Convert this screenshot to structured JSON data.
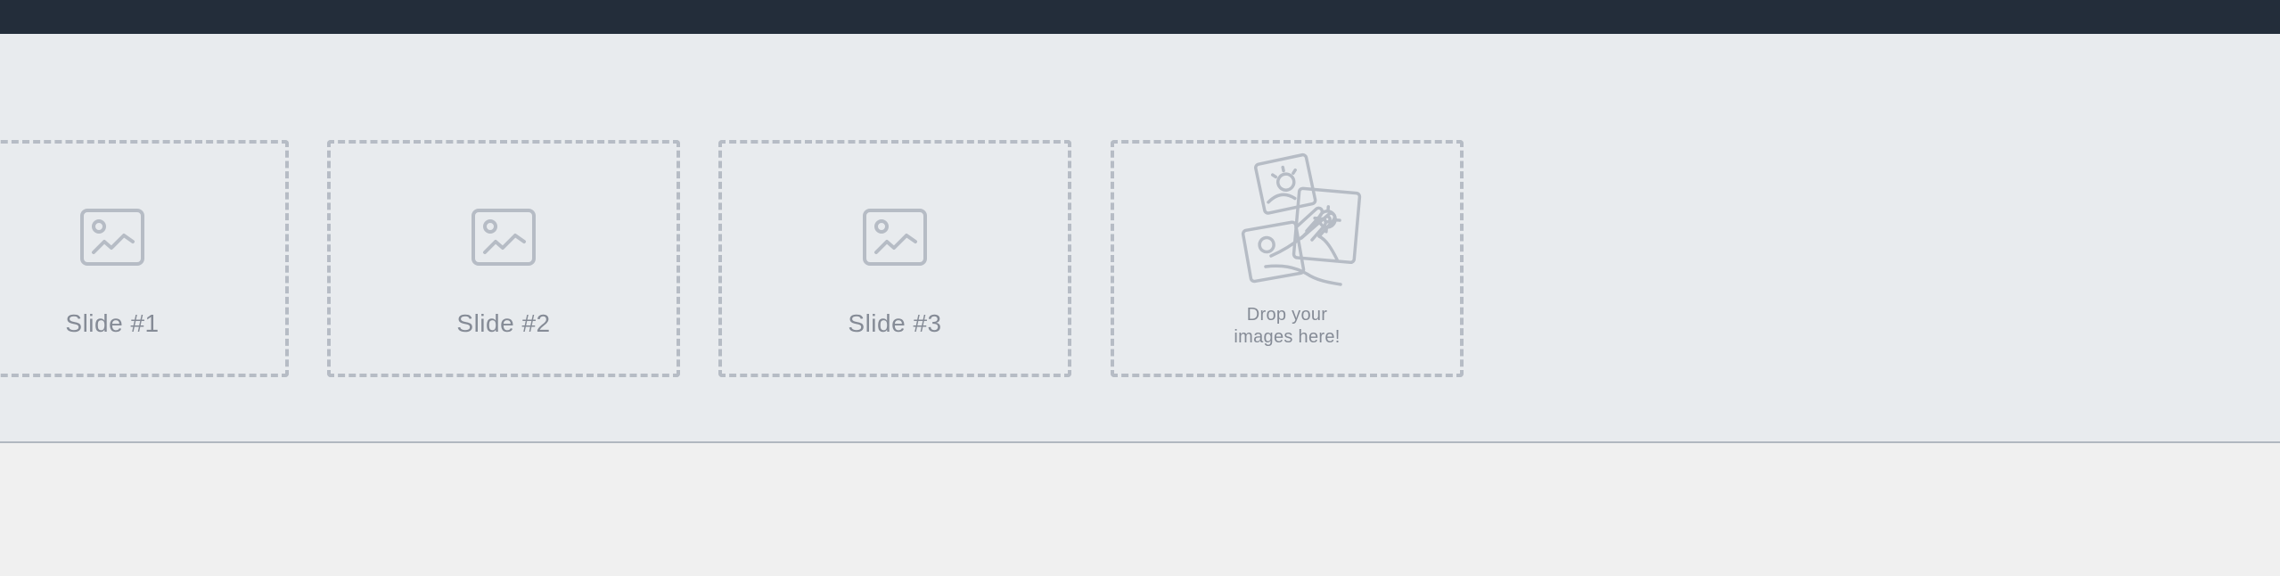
{
  "slides": [
    {
      "label": "Slide #1",
      "icon": "image-icon"
    },
    {
      "label": "Slide #2",
      "icon": "image-icon"
    },
    {
      "label": "Slide #3",
      "icon": "image-icon"
    }
  ],
  "dropzone": {
    "line1": "Drop your",
    "line2": "images here!",
    "icon": "drop-images-icon"
  },
  "colors": {
    "topbar": "#232d3a",
    "strip": "#e8ebee",
    "border": "#b6bcc5",
    "text": "#858b96",
    "page": "#f0f0f0"
  }
}
